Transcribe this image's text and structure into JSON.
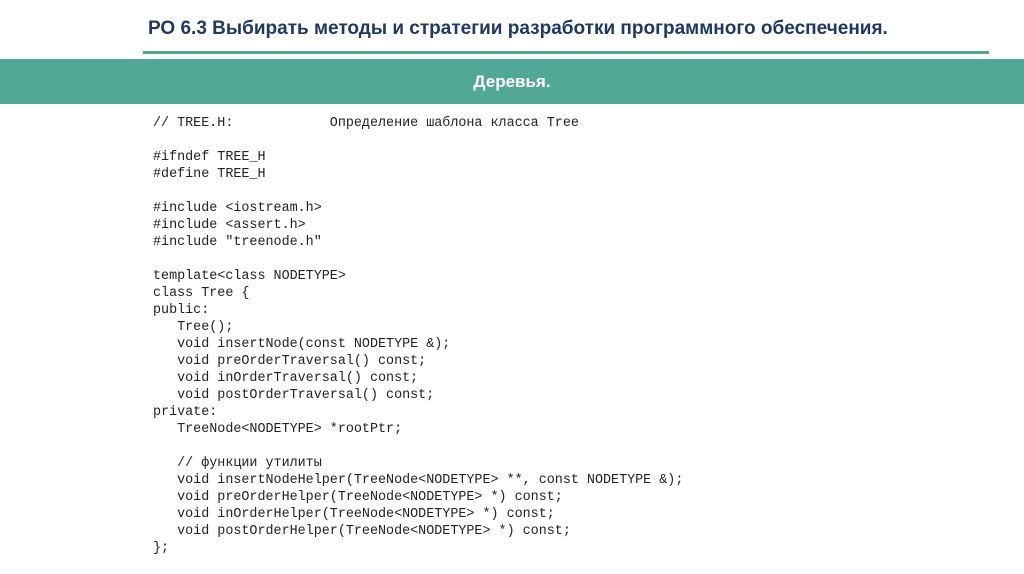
{
  "header": {
    "title": "РО 6.3 Выбирать методы и стратегии разработки программного обеспечения."
  },
  "banner": {
    "text": "Деревья."
  },
  "code": {
    "lines": [
      "// TREE.H:            Определение шаблона класса Tree",
      "",
      "#ifndef TREE_H",
      "#define TREE_H",
      "",
      "#include <iostream.h>",
      "#include <assert.h>",
      "#include \"treenode.h\"",
      "",
      "template<class NODETYPE>",
      "class Tree {",
      "public:",
      "   Tree();",
      "   void insertNode(const NODETYPE &);",
      "   void preOrderTraversal() const;",
      "   void inOrderTraversal() const;",
      "   void postOrderTraversal() const;",
      "private:",
      "   TreeNode<NODETYPE> *rootPtr;",
      "",
      "   // функции утилиты",
      "   void insertNodeHelper(TreeNode<NODETYPE> **, const NODETYPE &);",
      "   void preOrderHelper(TreeNode<NODETYPE> *) const;",
      "   void inOrderHelper(TreeNode<NODETYPE> *) const;",
      "   void postOrderHelper(TreeNode<NODETYPE> *) const;",
      "};"
    ]
  }
}
